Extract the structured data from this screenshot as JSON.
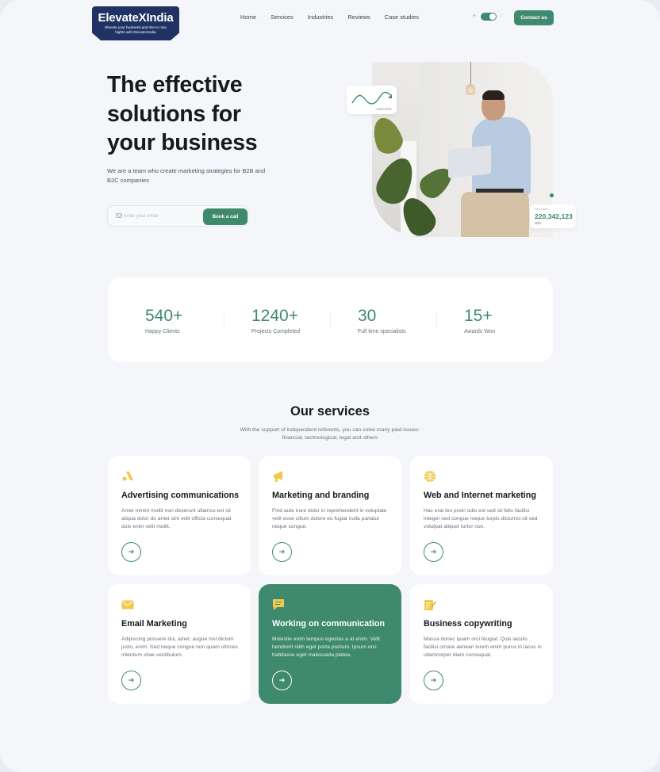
{
  "logo": {
    "title": "ElevateXIndia",
    "tagline": "Elevate your business and rise to new hights with ElevateXIndia"
  },
  "nav": {
    "items": [
      "Home",
      "Services",
      "Industries",
      "Reviews",
      "Case studies"
    ]
  },
  "header": {
    "contact_label": "Contact us"
  },
  "hero": {
    "title": "The effective solutions for your business",
    "subtitle": "We are a team who create marketing strategies for B2B and B2C companies",
    "email_placeholder": "Enter your email",
    "cta_label": "Book a call",
    "growth_value": "+100.32%",
    "users_label": "Live users",
    "users_value": "220,342,123",
    "users_unit": "Mills"
  },
  "stats": [
    {
      "value": "540+",
      "label": "Happy Clients"
    },
    {
      "value": "1240+",
      "label": "Projects Completed"
    },
    {
      "value": "30",
      "label": "Full time specialists"
    },
    {
      "value": "15+",
      "label": "Awards Won"
    }
  ],
  "services": {
    "title": "Our services",
    "subtitle": "With the support of independent referents, you can solve many paid issues: financial, technological, legal and others",
    "cards": [
      {
        "title": "Advertising communications",
        "text": "Amet minim mollit non deserunt ullamco est sit aliqua dolor do amet sint velit officia consequat duis enim velit mollit.",
        "icon": "ads-icon"
      },
      {
        "title": "Marketing and branding",
        "text": "Find aute irure dolor in reprehenderit in voluptate velit esse cillum dolore eu fugiat nulla pariatur neque congue.",
        "icon": "megaphone-icon"
      },
      {
        "title": "Web and Internet marketing",
        "text": "Hac erat leo proin odio est sed sit felis facilisi integer sed congue neque turpis dictumst sit sed volutpat aliquet tortor non.",
        "icon": "globe-icon"
      },
      {
        "title": "Email Marketing",
        "text": "Adipiscing posuere dui, amet, augue nisl dictum justo, enim. Sed neque congue non quam ultrices interdum vitae vestibulum.",
        "icon": "envelope-icon"
      },
      {
        "title": "Working on communication",
        "text": "Molestie enim tempus egestas a at enim. Velit hendrerit nibh eget porta pretium. Ipsum orci habitasse eget malesuada platea.",
        "icon": "chat-icon"
      },
      {
        "title": "Business copywriting",
        "text": "Massa donec quam orci feugiat. Quis iaculis facilisi ornare aenean lorem enim purus in lacus in ullamcorper diam consequat.",
        "icon": "edit-icon"
      }
    ]
  },
  "colors": {
    "accent": "#3f8a6e",
    "icon_yellow": "#f2c94c",
    "logo_bg": "#203264"
  }
}
